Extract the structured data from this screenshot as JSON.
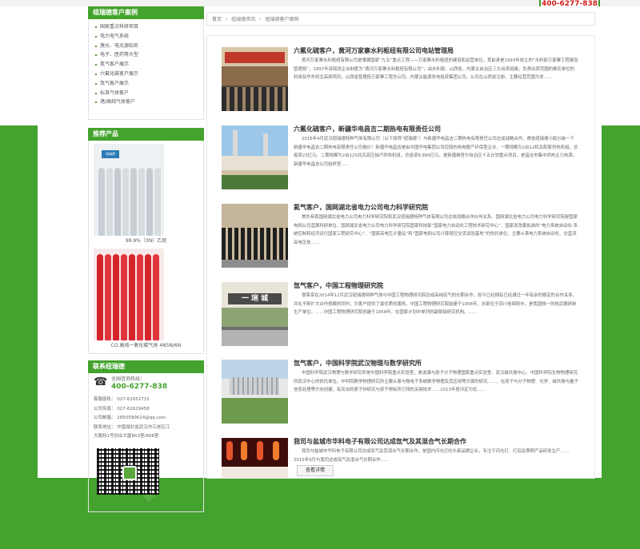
{
  "header": {
    "phone": "400-6277-838"
  },
  "sidebar": {
    "cases_title": "组瑞德客户案例",
    "categories": [
      "国家重点科研项目",
      "电力电气系统",
      "激光、电光源知名",
      "电子、医药等大型",
      "氮气客户展示",
      "六氟化硫客户展示",
      "氙气客户展示",
      "标准气体客户",
      "港/高纯气体客户"
    ],
    "recommend_title": "推荐产品",
    "products": [
      {
        "caption": "99.9%（3N）乙烷",
        "color": "#d8dde1"
      },
      {
        "caption": "CO.高纯一氧化碳气体 4N5N/6N",
        "color": "#d6232a"
      }
    ],
    "contact_title": "联系纽瑞德",
    "hotline_label": "全国咨询热线：",
    "hotline": "400-6277-838",
    "lines": [
      "客服座机：  027-62652715",
      "公司传真：  027-62629458",
      "公司邮箱：  2850590614@qq.com",
      "联系地址：  中国湖北省武汉市江岸区江",
      "大路特1号创业大厦803室/808室"
    ]
  },
  "breadcrumb": {
    "home": "首页",
    "sep": "›",
    "level1": "纽瑞德资讯",
    "level2": "纽瑞德客户案例"
  },
  "articles": [
    {
      "title": "六氟化硫客户，黄河万家寨水利枢纽有限公司电站管理局",
      "text": "黄河万家寨水利枢纽有限公司是隶属国家“九五”重点工程——万家寨水利枢纽的建设和运营单位，其前身是1993年成立的“水利部万家寨工程建设管理局”。1997年该局改企业制度为“黄河万家寨水利枢纽有限公司”，由水利部、山西省、内蒙古自治区三方出资组建，负责出资范围的做实单位的利用及华东利北高原项目，山西省管理段万家寨工程总公司。内蒙古能源发电投资集团公司。公司在山西省注册，主要经营范围为发……"
    },
    {
      "title": "六氟化硫客户，新疆华电昌吉二期热电有限责任公司",
      "text": "2016年4月武汉纽瑞德特种气体有限公司（以下简称“纽瑞德”）与新疆华电昌吉二期热电有限责任公司达成战略合作，首批纽瑞德小瓶分装一下新疆华电昌吉二期热电有限责任公司报价！新疆华电昌吉是由中国华电集团公司控股的热电联产环保型企业，一期规模为2台12机及配套供热机组，总投资23亿元。二期规模为2台125兆瓦高压抽汽供热机组，总投资9.899亿元，是新疆维吾尔自治区十五计划重点项目，是昌吉市集中供热主力热源。新疆华电昌吉公司始终坚……"
    },
    {
      "title": "氦气客户，国网湖北省电力公司电力科学研究院",
      "text": "首先恭喜国网湖北省电力公司电力科学研究院和武汉纽瑞德特种气体有限公司达成战略合作伙伴关系。国网湖北省电力公司电力科学研究院是国家电网公司直属科研单位，国网湖北省电力公司电力科学研究院国家科技部“国家电力自动化工程技术研究中心”、国家发改委批准的“电力系统自动化·系统控制和经济运行国家工程研究中心”、“国家高电压计量站”和“国家电网公司计算局压交流试验基地”的依托单位，主要从事电力系统自动化、交直流高电压技……"
    },
    {
      "title": "氙气客户，中国工程物理研究院",
      "text": "很荣幸在2014年12月武汉纽瑞德特种气体与中国工程物理研究院达成高纯氙气的长期合作，如今已经拥有已经通过一年有余的稳定的合作关系，并在不断扩大合作规模的同时，为客户提供了最优质的服务。中国工程物理研究院始建于1958年，总部位于四川省绵阳市，是我国唯一的核武器研制生产单位。……中国工程物理研究院创建于1958年，在国家计划中单列的副部级研究机构。……"
    },
    {
      "title": "氙气客户，中国科学院武汉物理与数学研究所",
      "text": "中国科学院武汉物理与数学研究所是中国科学院重点实验室，是波谱与原子分子物理国家重点实验室、武汉磁共振中心、中国科学院生物物理研究所武汉中心的依托单位。中科院数学物理研究所主要从事与微电子系统数学物理及其应用等方面的研究……、在原子与分子物理、光学、磁共振与量子信息处理等方向创建，有突出的原子钟研究与原子频标所引领的关键技术……2013年度评定为优……"
    },
    {
      "title": "我司与盐城市华科电子有限公司达成氙气及其混合气长期合作",
      "text": "我司与盐城市华科电子有限公司达成氙气及其混合气长期合作，是国内闪光灯的头部品牌企业，专注于闪光灯、灯泡及照明产品研发生产……2015年9月与我司达成氙气及混合气长期合作……",
      "more": "查看详情"
    }
  ]
}
